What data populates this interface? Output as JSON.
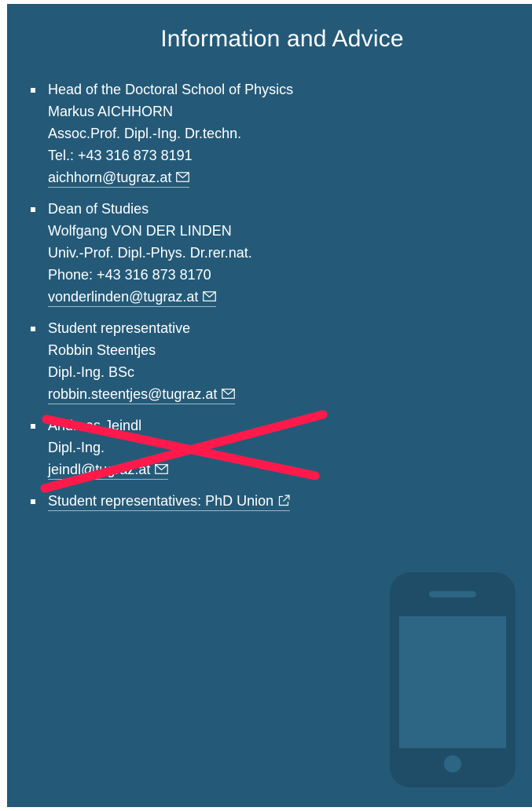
{
  "panel": {
    "title": "Information and Advice",
    "bg_color": "#245a78"
  },
  "contacts": [
    {
      "role": "Head of the Doctoral School of Physics",
      "name": "Markus AICHHORN",
      "degree": "Assoc.Prof. Dipl.-Ing. Dr.techn.",
      "phone": "Tel.: +43 316 873 8191",
      "email": "aichhorn@tugraz.at"
    },
    {
      "role": "Dean of Studies",
      "name": "Wolfgang VON DER LINDEN",
      "degree": "Univ.-Prof. Dipl.-Phys. Dr.rer.nat.",
      "phone": "Phone: +43 316 873 8170",
      "email": "vonderlinden@tugraz.at"
    },
    {
      "role": "Student representative",
      "name": "Robbin Steentjes",
      "degree": "Dipl.-Ing. BSc",
      "email": "robbin.steentjes@tugraz.at"
    },
    {
      "name": "Andreas Jeindl",
      "degree": "Dipl.-Ing.",
      "email": "jeindl@tugraz.at",
      "crossed_out": true,
      "cross_color": "#ff1a4b"
    }
  ],
  "phd_union_link": {
    "label": "Student representatives: PhD Union",
    "icon": "external-link-icon"
  },
  "icons": {
    "mail": "mail-icon",
    "decor": "phone-icon"
  }
}
